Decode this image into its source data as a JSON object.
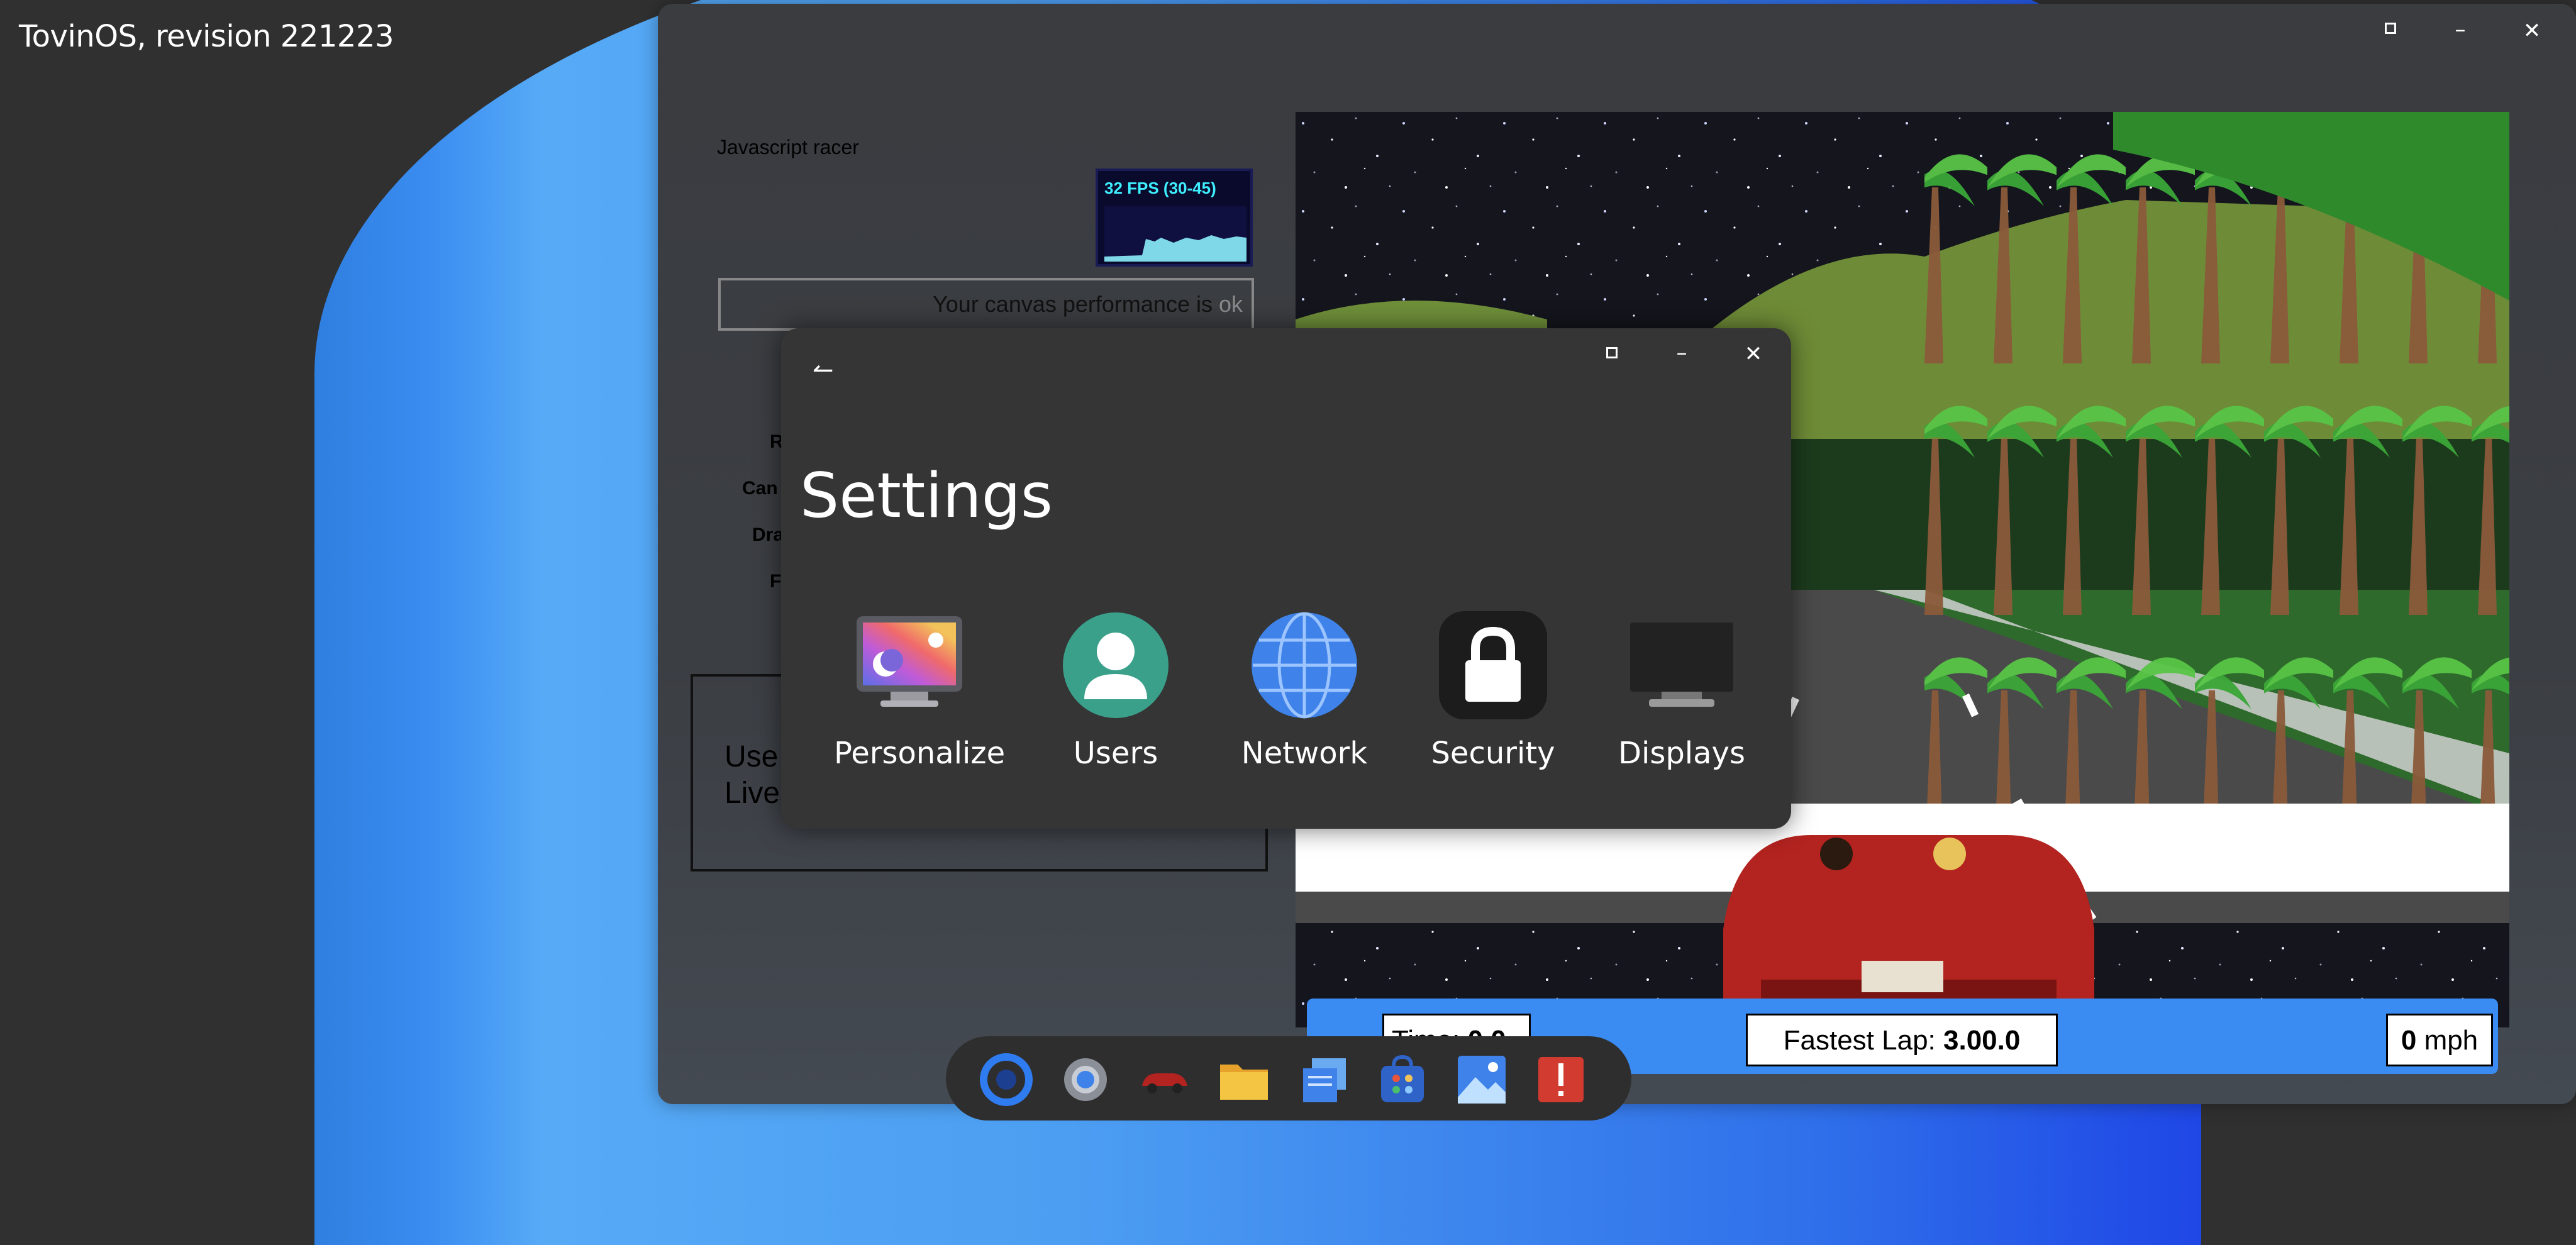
{
  "desktop": {
    "os_label": "TovinOS, revision 221223"
  },
  "racer_window": {
    "controls": {
      "maximize": "□",
      "minimize": "–",
      "close": "✕"
    },
    "game_title": "Javascript racer",
    "fps": {
      "label": "32 FPS (30-45)"
    },
    "perf": {
      "text": "Your canvas performance is ",
      "status": "ok"
    },
    "side_labels": [
      "R",
      "Can",
      "Dra",
      "F"
    ],
    "stats": {
      "line1": "Use",
      "line2": "Lives"
    },
    "hud": {
      "time_label": "Time:",
      "time_value": "0.0",
      "fastest_label": "Fastest Lap:",
      "fastest_value": "3.00.0",
      "speed_value": "0",
      "speed_unit": "mph"
    }
  },
  "settings": {
    "back_icon": "back-arrow",
    "controls": {
      "maximize": "□",
      "minimize": "–",
      "close": "✕"
    },
    "title": "Settings",
    "items": [
      {
        "label": "Personalize",
        "icon": "personalize-icon"
      },
      {
        "label": "Users",
        "icon": "users-icon"
      },
      {
        "label": "Network",
        "icon": "globe-icon"
      },
      {
        "label": "Security",
        "icon": "lock-icon"
      },
      {
        "label": "Displays",
        "icon": "monitor-icon"
      }
    ]
  },
  "dock": {
    "apps": [
      "launcher-icon",
      "settings-gear-icon",
      "racer-car-icon",
      "folder-icon",
      "notes-icon",
      "store-icon",
      "photos-icon",
      "alert-icon"
    ]
  },
  "colors": {
    "wallpaper_blue": "#4c9ef2",
    "hud_blue": "#3b8cf2",
    "dialog_bg": "#353535"
  }
}
